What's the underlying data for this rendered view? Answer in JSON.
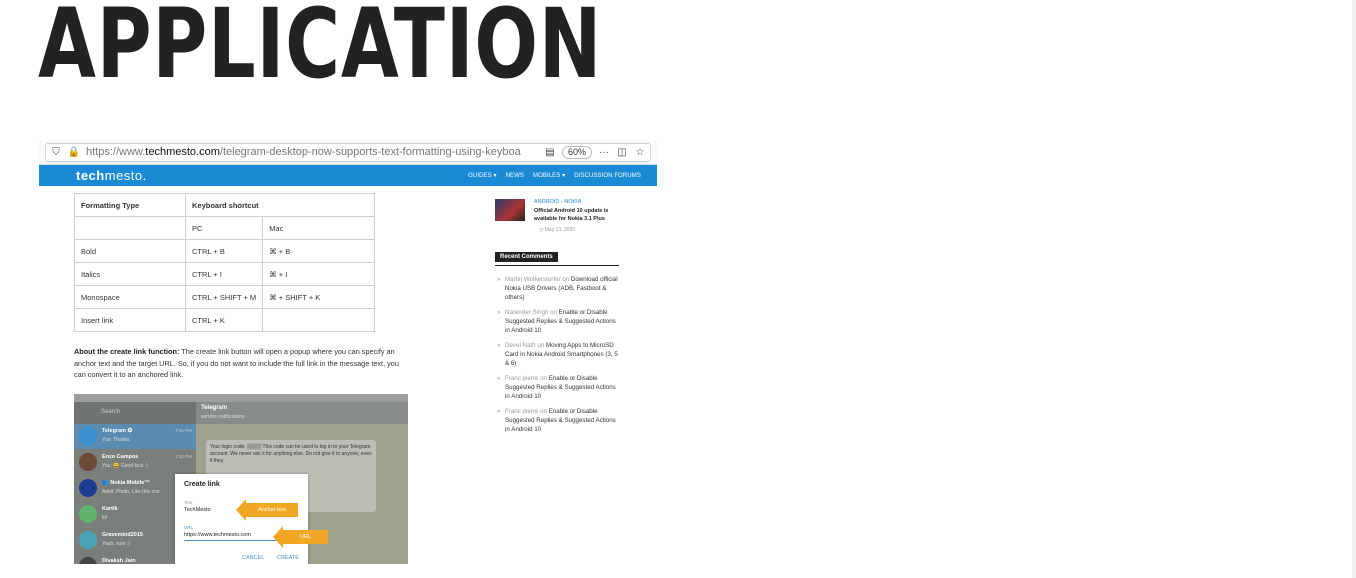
{
  "heading": "APPLICATION",
  "browser": {
    "url_prefix": "https://www.",
    "url_domain": "techmesto.com",
    "url_path": "/telegram-desktop-now-supports-text-formatting-using-keyboa",
    "zoom": "60%"
  },
  "site": {
    "logo_bold": "tech",
    "logo_light": "mesto.",
    "nav": [
      "GUIDES ▾",
      "NEWS",
      "MOBILES ▾",
      "DISCUSSION FORUMS"
    ]
  },
  "table": {
    "headers": [
      "Formatting Type",
      "Keyboard shortcut"
    ],
    "subheaders": [
      "",
      "PC",
      "Mac"
    ],
    "rows": [
      [
        "Bold",
        "CTRL + B",
        "⌘ + B"
      ],
      [
        "Italics",
        "CTRL + I",
        "⌘ + I"
      ],
      [
        "Monospace",
        "CTRL + SHIFT + M",
        "⌘ + SHIFT + K"
      ],
      [
        "Insert link",
        "CTRL + K",
        ""
      ]
    ]
  },
  "paragraph": {
    "bold": "About the create link function:",
    "text": " The create link button will open a popup where you can specify an anchor text and the target URL. So, if you do not want to include the full link in the message text, you can convert it to an anchored link."
  },
  "telegram": {
    "search": "Search",
    "chat_title": "Telegram",
    "chat_sub": "service notifications",
    "chats": [
      {
        "name": "Telegram ✪",
        "snippet": "You: Thanks",
        "time": "7:41 PM",
        "color": "#3b8fd1"
      },
      {
        "name": "Enzo Campos",
        "snippet": "You: 😀 Good luck :)",
        "time": "7:21 PM",
        "color": "#6b4b3a"
      },
      {
        "name": "👥 Nokia Mobile™",
        "snippet": "Ankit: Photo, Like this one",
        "time": "",
        "color": "#1c3d8f"
      },
      {
        "name": "Kartik",
        "snippet": "lol",
        "time": "",
        "color": "#5fb36b"
      },
      {
        "name": "Gravemind2015",
        "snippet": "Yeah, sure :)",
        "time": "",
        "color": "#4aa0b5"
      },
      {
        "name": "Divaksh Jain",
        "snippet": "",
        "time": "",
        "color": "#444"
      }
    ],
    "bubble_text": "Your login code: ▒▒▒▒ This code can be used to log in to your Telegram account. We never ask it for anything else. Do not give it to anyone, even if they",
    "dialog": {
      "title": "Create link",
      "text_label": "Text",
      "text_value": "TechMesto",
      "url_label": "URL",
      "url_value": "https://www.techmesto.com",
      "cancel": "CANCEL",
      "create": "CREATE",
      "anchor_tag": "Anchor text",
      "url_tag": "URL"
    }
  },
  "sidebar": {
    "post_category": "ANDROID › NOKIA",
    "post_title": "Official Android 10 update is available for Nokia 3.1 Plus",
    "post_date": "May 13, 2020",
    "recent_title": "Recent Comments",
    "comments": [
      {
        "author": "Martin Wolkerstorfer",
        "on": " on ",
        "post": "Download official Nokia USB Drivers (ADB, Fastboot & others)"
      },
      {
        "author": "Narender Singh",
        "on": " on ",
        "post": "Enable or Disable Suggested Replies & Suggested Actions in Android 10"
      },
      {
        "author": "Devol Nath",
        "on": " on ",
        "post": "Moving Apps to MicroSD Card in Nokia Android Smartphones (3, 5 & 6)"
      },
      {
        "author": "Franc pierre",
        "on": " on ",
        "post": "Enable or Disable Suggested Replies & Suggested Actions in Android 10"
      },
      {
        "author": "Franc pierre",
        "on": " on ",
        "post": "Enable or Disable Suggested Replies & Suggested Actions in Android 10"
      }
    ]
  }
}
